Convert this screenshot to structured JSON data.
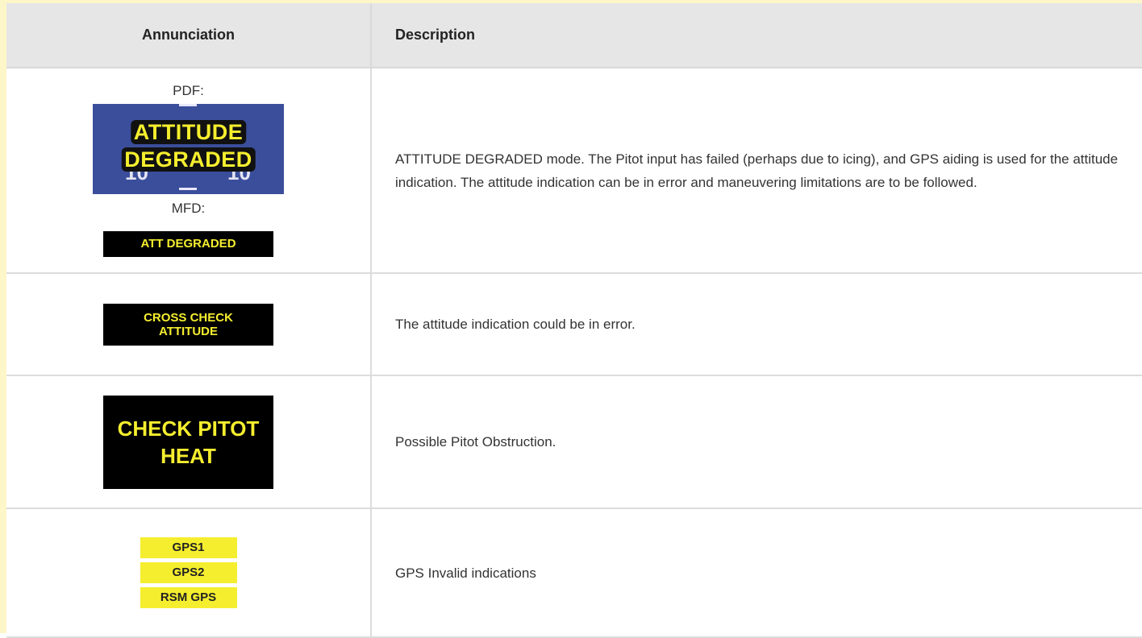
{
  "table": {
    "headers": {
      "annunciation": "Annunciation",
      "description": "Description"
    },
    "rows": [
      {
        "pfd_label": "PDF:",
        "pfd_words": [
          "ATTITUDE",
          "DEGRADED"
        ],
        "pfd_pitch_numbers": [
          "10",
          "10"
        ],
        "mfd_label": "MFD:",
        "mfd_annunciation": "ATT DEGRADED",
        "description": "ATTITUDE DEGRADED mode. The Pitot input has failed (perhaps due to icing), and GPS aiding is used for the attitude indication. The attitude indication can be in error and maneuvering limitations are to be followed."
      },
      {
        "annunciation_lines": [
          "CROSS CHECK",
          "ATTITUDE"
        ],
        "description": "The attitude indication could be in error."
      },
      {
        "annunciation_lines": [
          "CHECK PITOT",
          "HEAT"
        ],
        "description": "Possible Pitot Obstruction."
      },
      {
        "annunciation_items": [
          "GPS1",
          "GPS2",
          "RSM GPS"
        ],
        "description": "GPS Invalid indications"
      }
    ]
  },
  "colors": {
    "header_bg": "#e6e6e6",
    "annunciation_yellow": "#f5ee2e",
    "annunciation_black": "#000000",
    "pfd_sky_blue": "#3b4e9b"
  }
}
